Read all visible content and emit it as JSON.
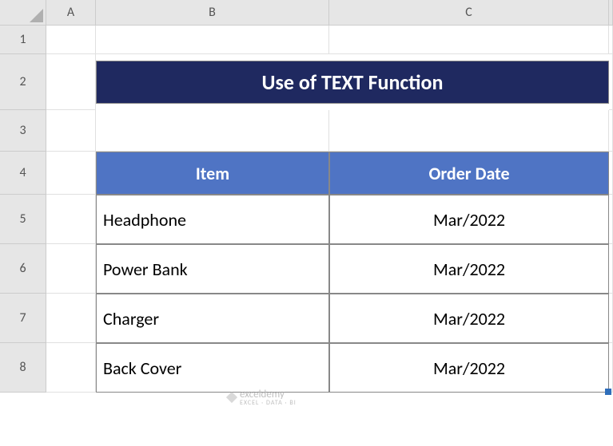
{
  "columns": [
    "A",
    "B",
    "C"
  ],
  "rows": [
    "1",
    "2",
    "3",
    "4",
    "5",
    "6",
    "7",
    "8"
  ],
  "title": "Use of TEXT Function",
  "headers": {
    "item": "Item",
    "order_date": "Order Date"
  },
  "data": [
    {
      "item": "Headphone",
      "order_date": "Mar/2022"
    },
    {
      "item": "Power Bank",
      "order_date": "Mar/2022"
    },
    {
      "item": "Charger",
      "order_date": "Mar/2022"
    },
    {
      "item": "Back Cover",
      "order_date": "Mar/2022"
    }
  ],
  "watermark": {
    "name": "exceldemy",
    "sub": "EXCEL · DATA · BI"
  },
  "chart_data": {
    "type": "table",
    "title": "Use of TEXT Function",
    "columns": [
      "Item",
      "Order Date"
    ],
    "rows": [
      [
        "Headphone",
        "Mar/2022"
      ],
      [
        "Power Bank",
        "Mar/2022"
      ],
      [
        "Charger",
        "Mar/2022"
      ],
      [
        "Back Cover",
        "Mar/2022"
      ]
    ]
  }
}
